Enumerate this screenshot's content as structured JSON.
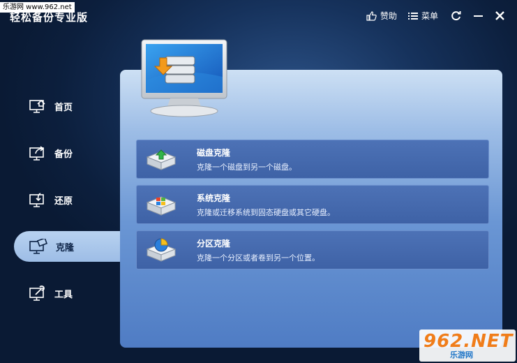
{
  "watermark_top": "乐游网 www.962.net",
  "watermark_bottom": {
    "big": "962.NET",
    "small": "乐游网"
  },
  "window": {
    "title": "轻松备份专业版"
  },
  "top_actions": {
    "like_label": "赞助",
    "menu_label": "菜单"
  },
  "nav": {
    "items": [
      {
        "label": "首页",
        "icon": "home-monitor-icon"
      },
      {
        "label": "备份",
        "icon": "backup-monitor-icon"
      },
      {
        "label": "还原",
        "icon": "restore-monitor-icon"
      },
      {
        "label": "克隆",
        "icon": "clone-monitor-icon",
        "active": true
      },
      {
        "label": "工具",
        "icon": "tools-monitor-icon"
      }
    ]
  },
  "cards": [
    {
      "title": "磁盘克隆",
      "desc": "克隆一个磁盘到另一个磁盘。",
      "icon": "disk-clone-icon"
    },
    {
      "title": "系统克隆",
      "desc": "克隆或迁移系统到固态硬盘或其它硬盘。",
      "icon": "system-clone-icon"
    },
    {
      "title": "分区克隆",
      "desc": "克隆一个分区或者卷到另一个位置。",
      "icon": "partition-clone-icon"
    }
  ],
  "colors": {
    "accent": "#9dbde6",
    "card": "#4268ac",
    "bg": "#16325c"
  }
}
